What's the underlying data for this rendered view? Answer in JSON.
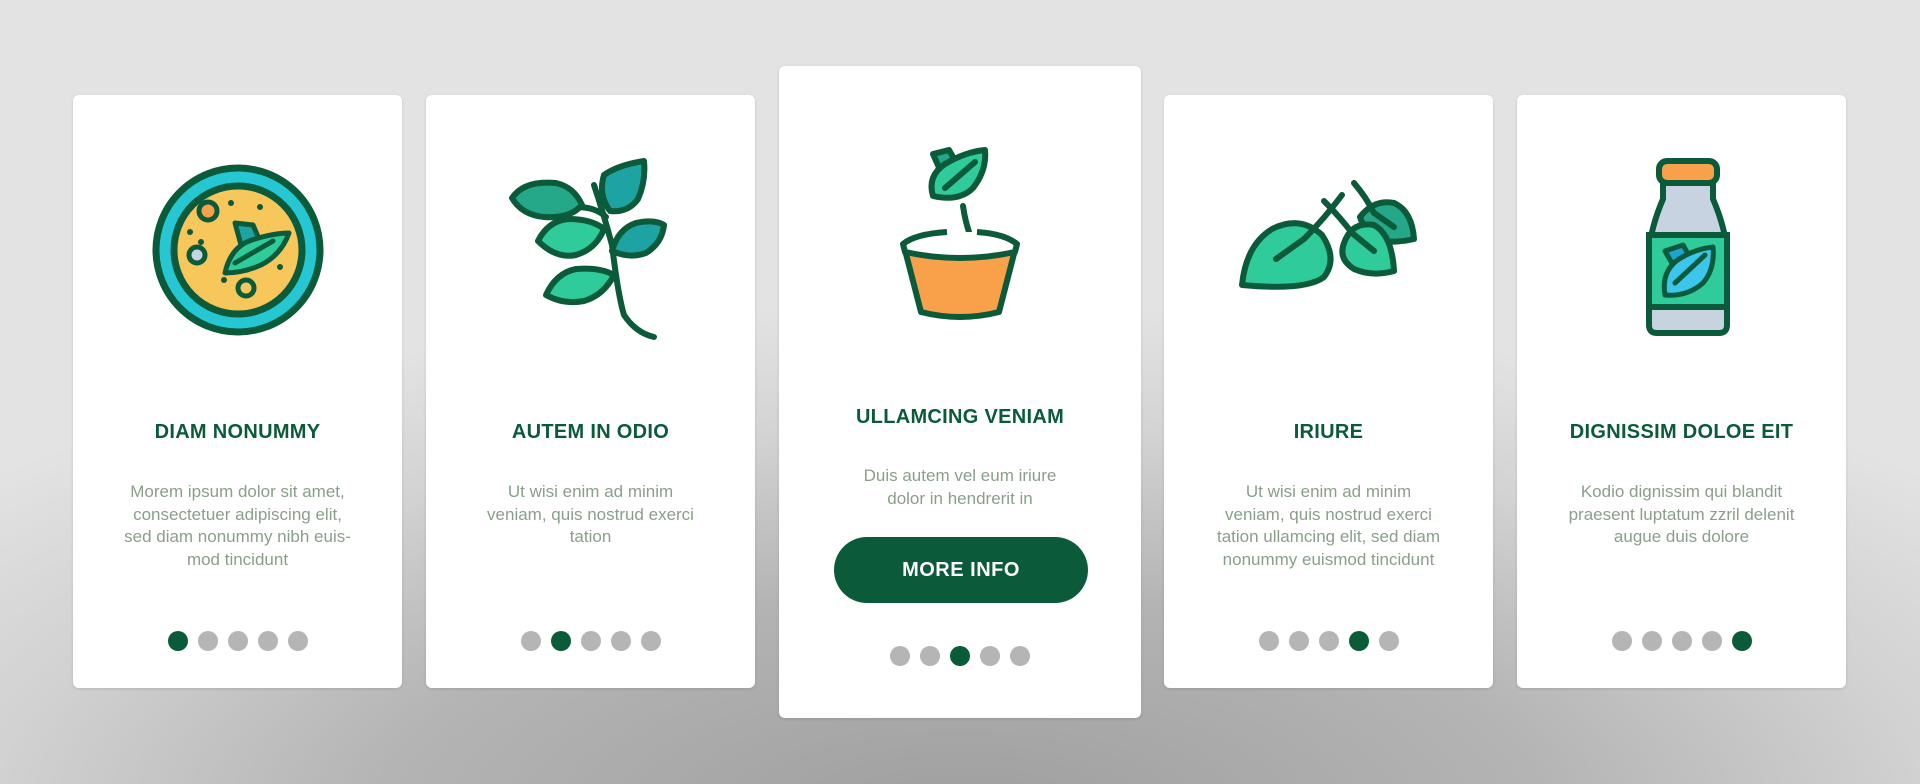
{
  "colors": {
    "primary": "#0b5a3a",
    "dot_inactive": "#b5b5b5",
    "description": "#8a9f8a",
    "leaf_light": "#2fcb9b",
    "leaf_mid": "#25a889",
    "leaf_teal": "#1ea3a3",
    "soup_yellow": "#f8c75c",
    "bowl_cyan": "#25c8d2",
    "pot_orange": "#f8a04a",
    "bottle_gray": "#c7d3e0",
    "label_blue": "#3cc6ec"
  },
  "cards": [
    {
      "icon": "soup-bowl-with-basil-icon",
      "title": "DIAM NONUMMY",
      "description": [
        "Morem ipsum dolor sit amet,",
        "consectetuer adipiscing elit,",
        "sed diam nonummy nibh euis-",
        "mod tincidunt"
      ],
      "active_dot": 1,
      "total_dots": 5
    },
    {
      "icon": "basil-branch-icon",
      "title": "AUTEM IN ODIO",
      "description": [
        "Ut wisi enim ad minim",
        "veniam, quis nostrud exerci",
        "tation"
      ],
      "active_dot": 2,
      "total_dots": 5
    },
    {
      "icon": "basil-sprout-pot-icon",
      "title": "ULLAMCING VENIAM",
      "description": [
        "Duis autem vel eum iriure",
        "dolor in hendrerit in"
      ],
      "button_label": "MORE INFO",
      "active_dot": 3,
      "total_dots": 5
    },
    {
      "icon": "basil-leaves-icon",
      "title": "IRIURE",
      "description": [
        "Ut wisi enim ad minim",
        "veniam, quis nostrud exerci",
        "tation ullamcing elit, sed diam",
        "nonummy euismod tincidunt"
      ],
      "active_dot": 4,
      "total_dots": 5
    },
    {
      "icon": "basil-drink-bottle-icon",
      "title": "DIGNISSIM DOLOE EIT",
      "description": [
        "Kodio dignissim qui blandit",
        "praesent luptatum zzril delenit",
        "augue duis dolore"
      ],
      "active_dot": 5,
      "total_dots": 5
    }
  ]
}
